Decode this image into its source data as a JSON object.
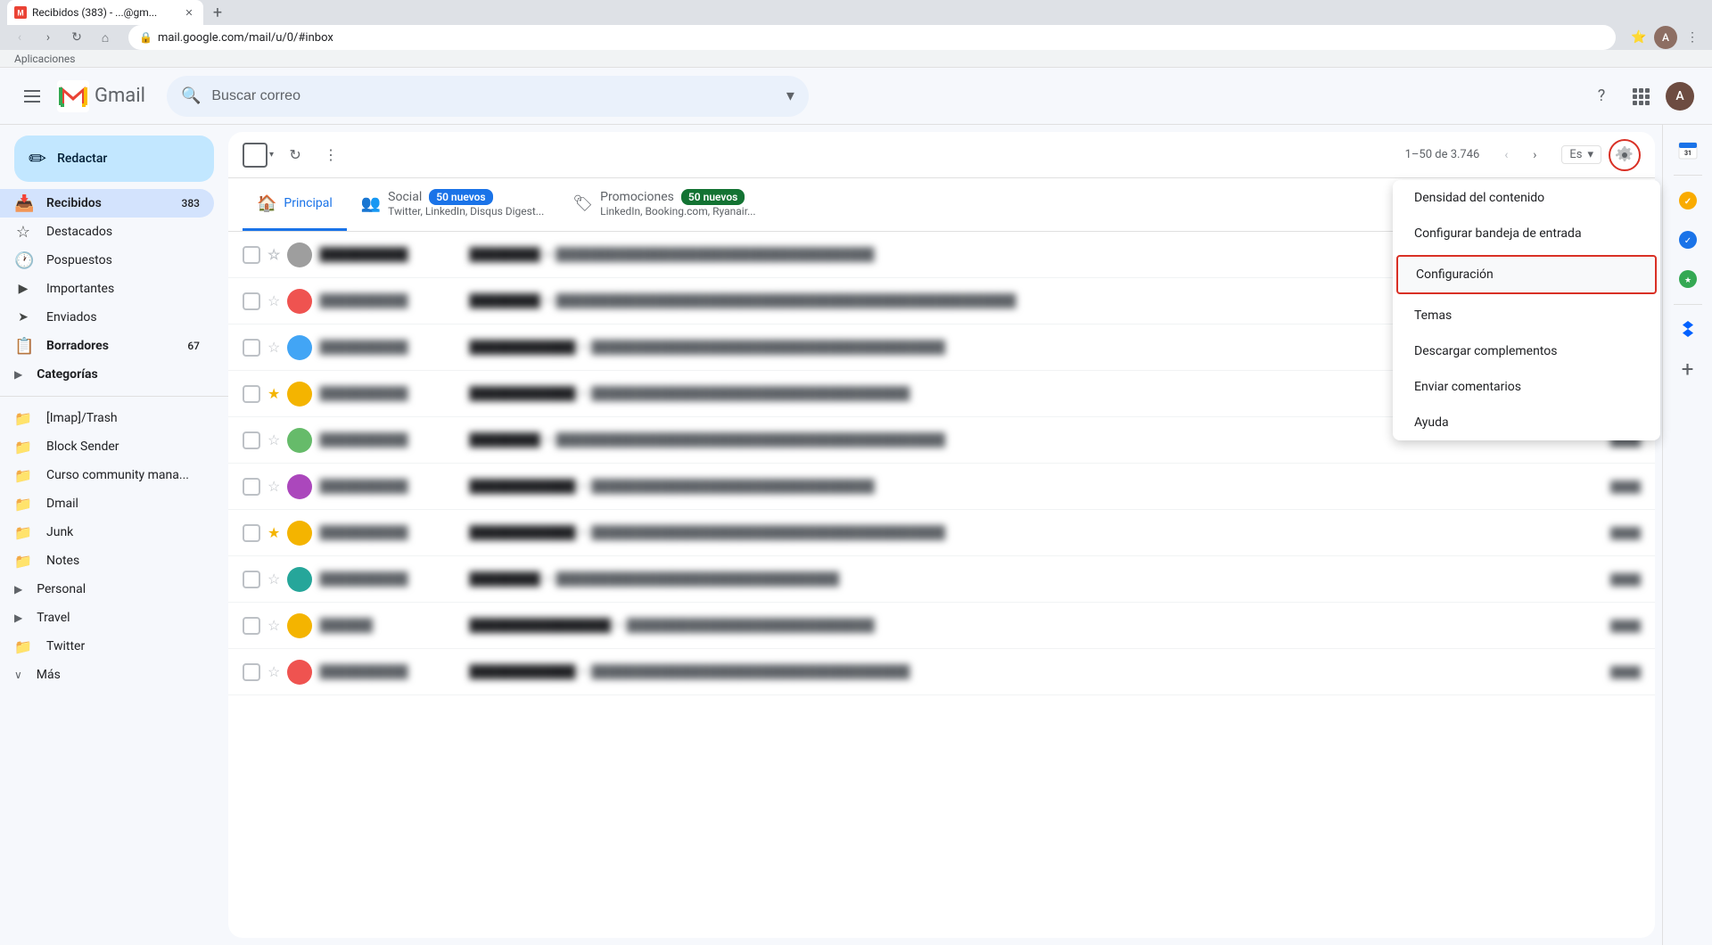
{
  "browser": {
    "tab": {
      "title": "Recibidos (383) - ...@gm...",
      "favicon": "M"
    },
    "address": "mail.google.com/mail/u/0/#inbox",
    "apps_label": "Aplicaciones"
  },
  "header": {
    "search_placeholder": "Buscar correo",
    "gmail_label": "Gmail"
  },
  "compose": {
    "label": "Redactar",
    "icon": "+"
  },
  "sidebar": {
    "items": [
      {
        "id": "recibidos",
        "label": "Recibidos",
        "icon": "📥",
        "count": "383",
        "active": true
      },
      {
        "id": "destacados",
        "label": "Destacados",
        "icon": "☆",
        "count": "",
        "active": false
      },
      {
        "id": "pospuestos",
        "label": "Pospuestos",
        "icon": "🕐",
        "count": "",
        "active": false
      },
      {
        "id": "importantes",
        "label": "Importantes",
        "icon": "▶",
        "count": "",
        "active": false
      },
      {
        "id": "enviados",
        "label": "Enviados",
        "icon": "➤",
        "count": "",
        "active": false
      },
      {
        "id": "borradores",
        "label": "Borradores",
        "icon": "📋",
        "count": "67",
        "active": false,
        "bold": true
      },
      {
        "id": "categorias",
        "label": "Categorías",
        "icon": "🏷",
        "count": "",
        "active": false,
        "bold": true,
        "hasChevron": true
      },
      {
        "id": "imap-trash",
        "label": "[Imap]/Trash",
        "icon": "📁",
        "count": "",
        "active": false
      },
      {
        "id": "block-sender",
        "label": "Block Sender",
        "icon": "📁",
        "count": "",
        "active": false
      },
      {
        "id": "curso-community",
        "label": "Curso community mana...",
        "icon": "📁",
        "count": "",
        "active": false
      },
      {
        "id": "dmail",
        "label": "Dmail",
        "icon": "📁",
        "count": "",
        "active": false
      },
      {
        "id": "junk",
        "label": "Junk",
        "icon": "📁",
        "count": "",
        "active": false
      },
      {
        "id": "notes",
        "label": "Notes",
        "icon": "📁",
        "count": "",
        "active": false
      },
      {
        "id": "personal",
        "label": "Personal",
        "icon": "📁",
        "count": "",
        "active": false,
        "hasChevron": true
      },
      {
        "id": "travel",
        "label": "Travel",
        "icon": "📁",
        "count": "",
        "active": false,
        "hasChevron": true
      },
      {
        "id": "twitter",
        "label": "Twitter",
        "icon": "📁",
        "count": "",
        "active": false
      },
      {
        "id": "mas",
        "label": "Más",
        "icon": "∨",
        "count": "",
        "active": false
      }
    ]
  },
  "toolbar": {
    "pagination": "1–50 de 3.746",
    "prev_disabled": true,
    "next_disabled": false
  },
  "tabs": [
    {
      "id": "principal",
      "label": "Principal",
      "icon": "🏠",
      "active": true,
      "badge": null,
      "subtitle": ""
    },
    {
      "id": "social",
      "label": "Social",
      "icon": "👥",
      "active": false,
      "badge": "50 nuevos",
      "badge_color": "blue",
      "subtitle": "Twitter, LinkedIn, Disqus Digest..."
    },
    {
      "id": "promociones",
      "label": "Promociones",
      "icon": "🏷",
      "active": false,
      "badge": "50 nuevos",
      "badge_color": "green",
      "subtitle": "LinkedIn, Booking.com, Ryanair..."
    }
  ],
  "emails": [
    {
      "id": 1,
      "sender": "",
      "subject": "",
      "preview": "",
      "time": "",
      "starred": false,
      "unread": true,
      "avatar_color": "#e8eaed",
      "blurred": true
    },
    {
      "id": 2,
      "sender": "",
      "subject": "",
      "preview": "",
      "time": "",
      "starred": false,
      "unread": false,
      "avatar_color": "#e8eaed",
      "blurred": true
    },
    {
      "id": 3,
      "sender": "",
      "subject": "",
      "preview": "",
      "time": "",
      "starred": false,
      "unread": false,
      "avatar_color": "#e8eaed",
      "blurred": true
    },
    {
      "id": 4,
      "sender": "",
      "subject": "",
      "preview": "",
      "time": "",
      "starred": true,
      "unread": false,
      "avatar_color": "#f4b400",
      "blurred": true
    },
    {
      "id": 5,
      "sender": "",
      "subject": "",
      "preview": "",
      "time": "",
      "starred": false,
      "unread": false,
      "avatar_color": "#e8eaed",
      "blurred": true
    },
    {
      "id": 6,
      "sender": "",
      "subject": "",
      "preview": "",
      "time": "",
      "starred": false,
      "unread": false,
      "avatar_color": "#e8eaed",
      "blurred": true
    },
    {
      "id": 7,
      "sender": "",
      "subject": "",
      "preview": "",
      "time": "",
      "starred": true,
      "unread": false,
      "avatar_color": "#f4b400",
      "blurred": true
    },
    {
      "id": 8,
      "sender": "",
      "subject": "",
      "preview": "",
      "time": "",
      "starred": false,
      "unread": false,
      "avatar_color": "#e8eaed",
      "blurred": true
    },
    {
      "id": 9,
      "sender": "",
      "subject": "",
      "preview": "",
      "time": "",
      "starred": false,
      "unread": false,
      "avatar_color": "#e8eaed",
      "blurred": true
    },
    {
      "id": 10,
      "sender": "",
      "subject": "",
      "preview": "",
      "time": "",
      "starred": false,
      "unread": false,
      "avatar_color": "#e8eaed",
      "blurred": true
    }
  ],
  "settings_dropdown": {
    "items": [
      {
        "id": "density",
        "label": "Densidad del contenido"
      },
      {
        "id": "configure-inbox",
        "label": "Configurar bandeja de entrada"
      },
      {
        "id": "settings",
        "label": "Configuración",
        "highlighted": true
      },
      {
        "id": "themes",
        "label": "Temas"
      },
      {
        "id": "addons",
        "label": "Descargar complementos"
      },
      {
        "id": "feedback",
        "label": "Enviar comentarios"
      },
      {
        "id": "help",
        "label": "Ayuda"
      }
    ]
  },
  "right_sidebar": {
    "icons": [
      {
        "id": "calendar",
        "symbol": "31",
        "label": "Calendar",
        "active": false
      },
      {
        "id": "tasks",
        "symbol": "✓",
        "label": "Tasks",
        "active": false
      },
      {
        "id": "keep",
        "symbol": "◆",
        "label": "Keep",
        "active": false
      },
      {
        "id": "dropbox",
        "symbol": "❑",
        "label": "Dropbox",
        "active": false
      }
    ]
  },
  "colors": {
    "accent_red": "#d93025",
    "accent_blue": "#1a73e8",
    "active_tab_bg": "#d3e3fd",
    "unread_bg": "#fff",
    "read_color": "#5f6368",
    "settings_highlight_border": "#d93025"
  }
}
